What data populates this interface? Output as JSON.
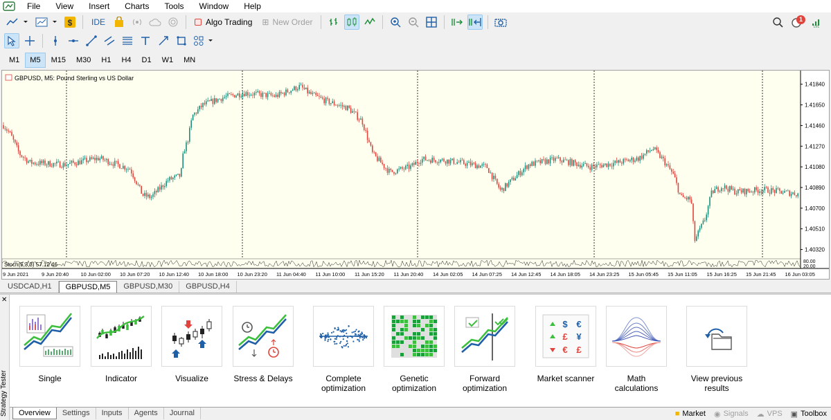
{
  "menu": {
    "items": [
      "File",
      "View",
      "Insert",
      "Charts",
      "Tools",
      "Window",
      "Help"
    ]
  },
  "toolbar": {
    "ide_label": "IDE",
    "algo_label": "Algo Trading",
    "new_order_label": "New Order",
    "notification_count": "1"
  },
  "timeframes": [
    "M1",
    "M5",
    "M15",
    "M30",
    "H1",
    "H4",
    "D1",
    "W1",
    "MN"
  ],
  "active_timeframe": "M5",
  "chart": {
    "title": "GBPUSD, M5:  Pound Sterling vs US Dollar",
    "indicator_label": "Stoch(5,3,3) 57.12 46",
    "price_labels": [
      "1.41840",
      "1.41650",
      "1.41460",
      "1.41270",
      "1.41080",
      "1.40890",
      "1.40700",
      "1.40510",
      "1.40320"
    ],
    "indicator_scale": [
      "80.00",
      "20.00"
    ],
    "time_labels": [
      "9 Jun 2021",
      "9 Jun 20:40",
      "10 Jun 02:00",
      "10 Jun 07:20",
      "10 Jun 12:40",
      "10 Jun 18:00",
      "10 Jun 23:20",
      "11 Jun 04:40",
      "11 Jun 10:00",
      "11 Jun 15:20",
      "11 Jun 20:40",
      "14 Jun 02:05",
      "14 Jun 07:25",
      "14 Jun 12:45",
      "14 Jun 18:05",
      "14 Jun 23:25",
      "15 Jun 05:45",
      "15 Jun 11:05",
      "15 Jun 16:25",
      "15 Jun 21:45",
      "16 Jun 03:05"
    ],
    "colors": {
      "bull": "#1b8f7a",
      "bear": "#e0443c",
      "background": "#fffff0"
    }
  },
  "chart_tabs": [
    "USDCAD,H1",
    "GBPUSD,M5",
    "GBPUSD,M30",
    "GBPUSD,H4"
  ],
  "active_chart_tab": "GBPUSD,M5",
  "tester": {
    "side_label": "Strategy Tester",
    "cards": [
      {
        "label1": "Single",
        "label2": ""
      },
      {
        "label1": "Indicator",
        "label2": ""
      },
      {
        "label1": "Visualize",
        "label2": ""
      },
      {
        "label1": "Stress & Delays",
        "label2": ""
      },
      {
        "label1": "Complete",
        "label2": "optimization"
      },
      {
        "label1": "Genetic",
        "label2": "optimization"
      },
      {
        "label1": "Forward",
        "label2": "optimization"
      },
      {
        "label1": "Market scanner",
        "label2": ""
      },
      {
        "label1": "Math",
        "label2": "calculations"
      },
      {
        "label1": "View previous",
        "label2": "results"
      }
    ]
  },
  "bottom_tabs": [
    "Overview",
    "Settings",
    "Inputs",
    "Agents",
    "Journal"
  ],
  "active_bottom_tab": "Overview",
  "status": {
    "market": "Market",
    "signals": "Signals",
    "vps": "VPS",
    "toolbox": "Toolbox"
  }
}
